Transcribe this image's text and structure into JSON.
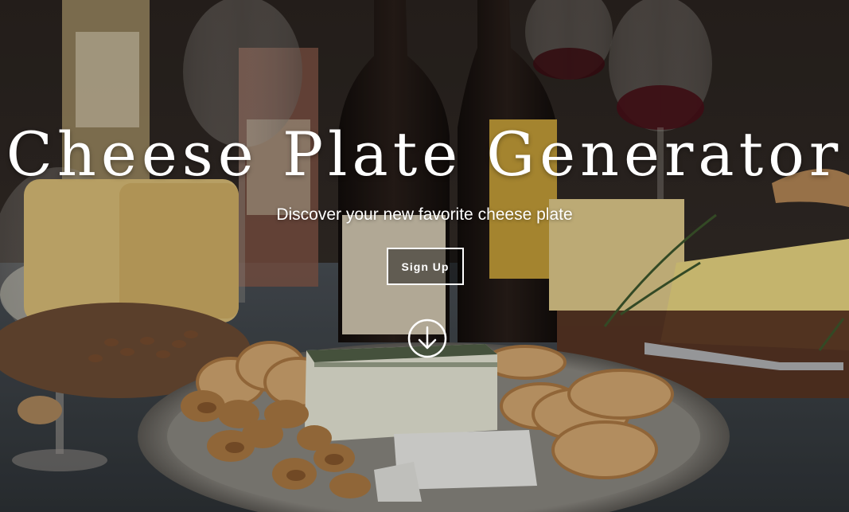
{
  "hero": {
    "title": "Cheese Plate Generator",
    "subtitle": "Discover your new favorite cheese plate",
    "signup_label": "Sign Up",
    "scroll_icon": "arrow-down-circle-icon",
    "background_image": "photo of wine bottles, wine glasses, cheeses, bread slices and walnuts on a rustic table",
    "text_color": "#ffffff"
  }
}
